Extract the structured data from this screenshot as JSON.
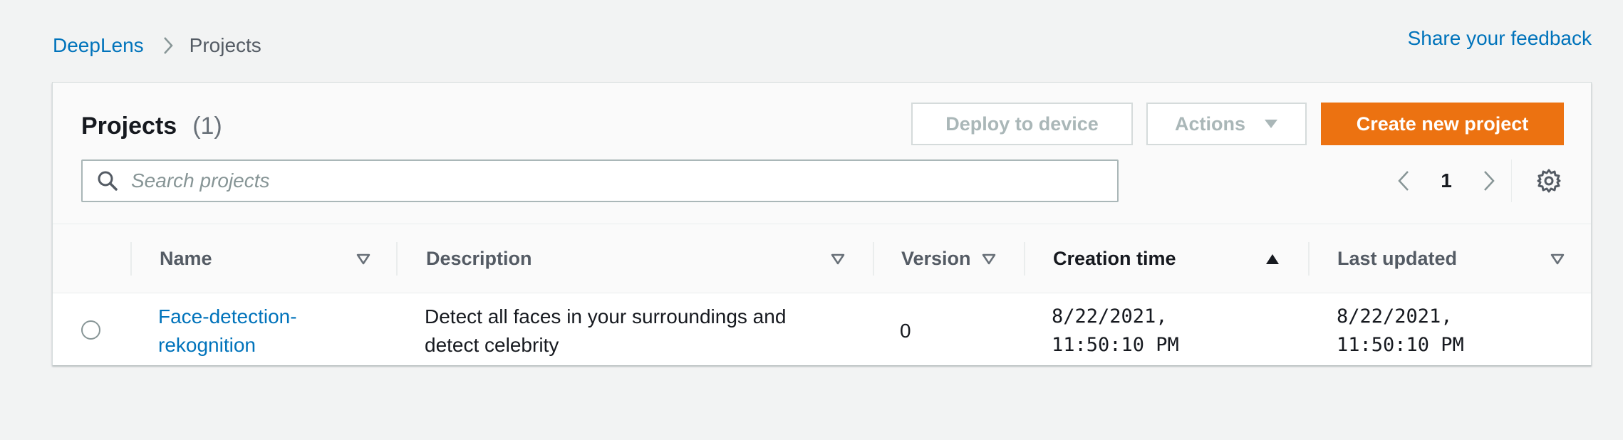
{
  "breadcrumb": {
    "root": "DeepLens",
    "current": "Projects"
  },
  "feedback_link": "Share your feedback",
  "header": {
    "title": "Projects",
    "count": "(1)",
    "deploy_label": "Deploy to device",
    "actions_label": "Actions",
    "create_label": "Create new project"
  },
  "search": {
    "placeholder": "Search projects",
    "value": ""
  },
  "pagination": {
    "current_page": "1"
  },
  "columns": {
    "name": "Name",
    "description": "Description",
    "version": "Version",
    "creation_time": "Creation time",
    "last_updated": "Last updated"
  },
  "sorting": {
    "column": "creation_time",
    "direction": "ascending"
  },
  "rows": [
    {
      "selected": false,
      "name_line1": "Face-detection-",
      "name_line2": "rekognition",
      "description_line1": "Detect all faces in your surroundings and",
      "description_line2": "detect celebrity",
      "version": "0",
      "created_line1": "8/22/2021,",
      "created_line2": "11:50:10 PM",
      "updated_line1": "8/22/2021,",
      "updated_line2": "11:50:10 PM"
    }
  ],
  "colors": {
    "link": "#0073bb",
    "primary_button": "#ec7211",
    "disabled_text": "#aab7b8",
    "background": "#f2f3f3"
  },
  "icons": {
    "breadcrumb_separator": "chevron-right-icon",
    "actions_caret": "caret-down-icon",
    "search": "search-icon",
    "prev_page": "chevron-left-icon",
    "next_page": "chevron-right-icon",
    "settings": "gear-icon",
    "sort_inactive": "sort-caret-outline-icon",
    "sort_active": "sort-caret-up-filled-icon"
  }
}
